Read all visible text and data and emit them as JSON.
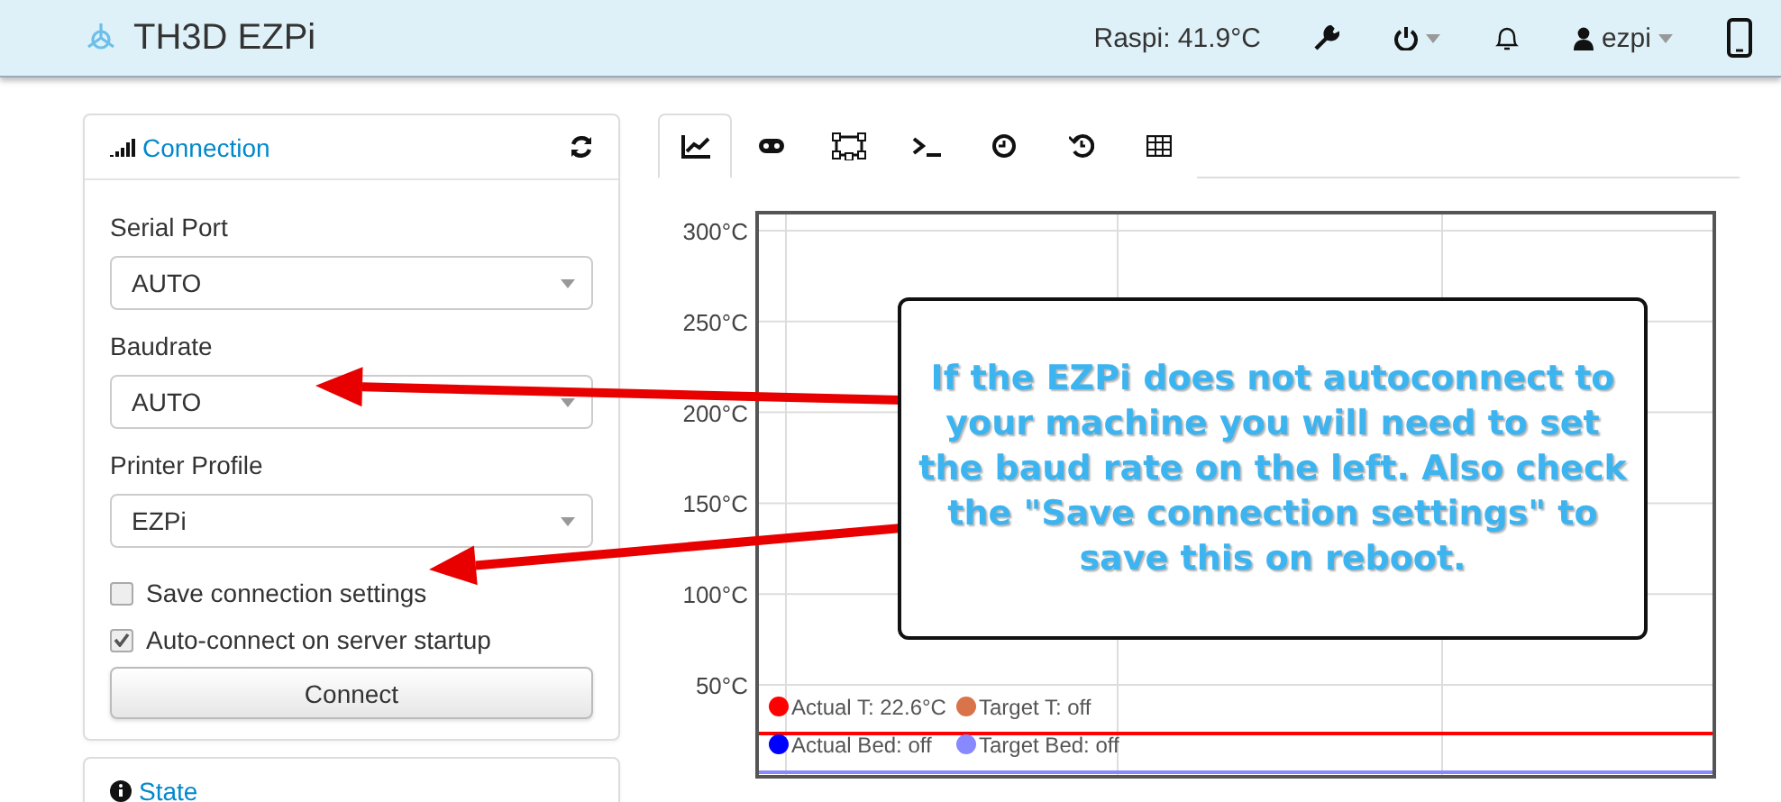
{
  "navbar": {
    "brand": "TH3D EZPi",
    "temperature": "Raspi: 41.9°C",
    "user": "ezpi"
  },
  "connection_panel": {
    "title": "Connection",
    "fields": [
      {
        "label": "Serial Port",
        "value": "AUTO"
      },
      {
        "label": "Baudrate",
        "value": "AUTO"
      },
      {
        "label": "Printer Profile",
        "value": "EZPi"
      }
    ],
    "options": [
      {
        "label": "Save connection settings",
        "checked": false
      },
      {
        "label": "Auto-connect on server startup",
        "checked": true
      }
    ],
    "button": "Connect"
  },
  "state_panel": {
    "title": "State"
  },
  "tabs": [
    {
      "kind": "graph",
      "selected": true
    },
    {
      "kind": "gamepad",
      "selected": false
    },
    {
      "kind": "webcam",
      "selected": false
    },
    {
      "kind": "terminal",
      "selected": false
    },
    {
      "kind": "timelapse",
      "selected": false
    },
    {
      "kind": "history",
      "selected": false
    },
    {
      "kind": "table",
      "selected": false
    }
  ],
  "temperature_graph": {
    "legend": [
      {
        "text": "Actual T: 22.6°C",
        "color": "#ff0000"
      },
      {
        "text": "Target T: off",
        "color": "#d9734a"
      },
      {
        "text": "Actual Bed: off",
        "color": "#0000ff"
      },
      {
        "text": "Target Bed: off",
        "color": "#8888ff"
      }
    ],
    "y_axis_labels": [
      "300°C",
      "250°C",
      "200°C",
      "150°C",
      "100°C",
      "50°C"
    ]
  },
  "callout": {
    "text": "If the EZPi does not autoconnect to your machine you will need to set the baud rate on the left. Also check the \"Save connection settings\" to save this on reboot."
  }
}
